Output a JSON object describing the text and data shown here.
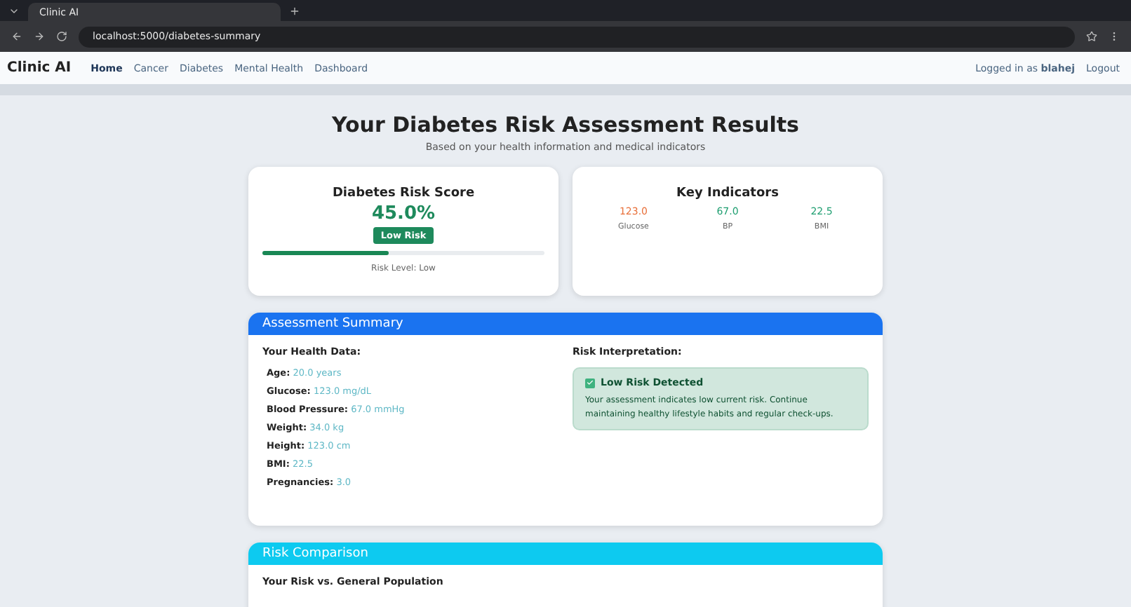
{
  "browser": {
    "tab_title": "Clinic AI",
    "url": "localhost:5000/diabetes-summary"
  },
  "navbar": {
    "brand": "Clinic AI",
    "links": [
      {
        "label": "Home",
        "selected": true
      },
      {
        "label": "Cancer",
        "selected": false
      },
      {
        "label": "Diabetes",
        "selected": false
      },
      {
        "label": "Mental Health",
        "selected": false
      },
      {
        "label": "Dashboard",
        "selected": false
      }
    ],
    "user_prefix": "Logged in as",
    "username": "blahej",
    "logout": "Logout"
  },
  "header": {
    "title": "Your Diabetes Risk Assessment Results",
    "subtitle": "Based on your health information and medical indicators"
  },
  "risk_score": {
    "title": "Diabetes Risk Score",
    "value": "45.0%",
    "badge": "Low Risk",
    "level": 0.45,
    "caption": "Risk Level: Low"
  },
  "key_indicators": {
    "title": "Key Indicators",
    "items": [
      {
        "value": "123.0",
        "label": "Glucose",
        "color": "#e8703a"
      },
      {
        "value": "67.0",
        "label": "BP",
        "color": "#1e9e70"
      },
      {
        "value": "22.5",
        "label": "BMI",
        "color": "#1e9e70"
      }
    ]
  },
  "summary": {
    "title": "Assessment Summary",
    "health_heading": "Your Health Data:",
    "fields": [
      {
        "label": "Age:",
        "value": "20.0 years"
      },
      {
        "label": "Glucose:",
        "value": "123.0 mg/dL"
      },
      {
        "label": "Blood Pressure:",
        "value": "67.0 mmHg"
      },
      {
        "label": "Weight:",
        "value": "34.0 kg"
      },
      {
        "label": "Height:",
        "value": "123.0 cm"
      },
      {
        "label": "BMI:",
        "value": "22.5"
      },
      {
        "label": "Pregnancies:",
        "value": "3.0"
      }
    ],
    "interpretation_heading": "Risk Interpretation:",
    "alert": {
      "checked": true,
      "title": "Low Risk Detected",
      "text": "Your assessment indicates low current risk. Continue maintaining healthy lifestyle habits and regular check-ups."
    }
  },
  "comparison": {
    "title": "Risk Comparison",
    "subtitle": "Your Risk vs. General Population"
  }
}
